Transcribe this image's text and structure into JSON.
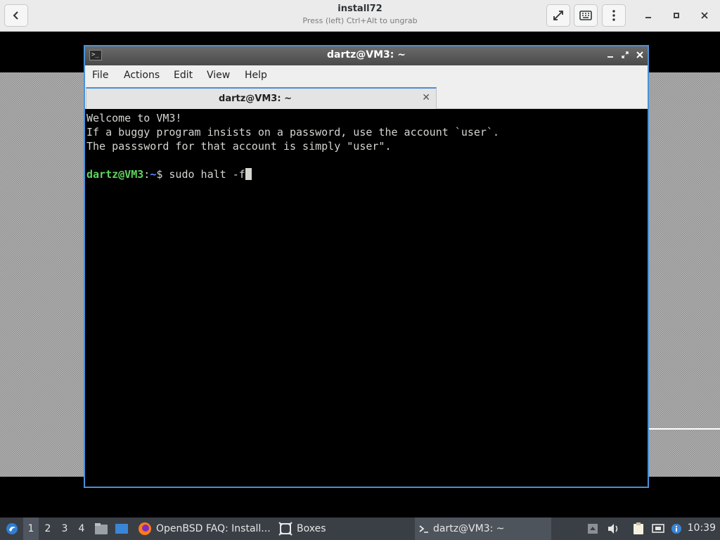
{
  "boxes": {
    "title": "install72",
    "subtitle": "Press (left) Ctrl+Alt to ungrab"
  },
  "terminal": {
    "window_title": "dartz@VM3: ~",
    "menu": [
      "File",
      "Actions",
      "Edit",
      "View",
      "Help"
    ],
    "tab_label": "dartz@VM3: ~",
    "lines": [
      "Welcome to VM3!",
      "If a buggy program insists on a password, use the account `user`.",
      "The passsword for that account is simply \"user\"."
    ],
    "prompt": {
      "user_host": "dartz@VM3",
      "colon": ":",
      "dir": "~",
      "symbol": "$ ",
      "command": "sudo halt -f"
    }
  },
  "taskbar": {
    "workspaces": [
      "1",
      "2",
      "3",
      "4"
    ],
    "tasks": [
      {
        "label": "OpenBSD FAQ: Install...",
        "icon": "firefox-icon"
      },
      {
        "label": "Boxes",
        "icon": "boxes-icon"
      },
      {
        "label": "dartz@VM3: ~",
        "icon": "terminal-icon"
      }
    ],
    "clock": "10:39"
  },
  "colors": {
    "accent": "#4a90d9",
    "prompt_user": "#5fd35f",
    "prompt_dir": "#5b8cff"
  }
}
